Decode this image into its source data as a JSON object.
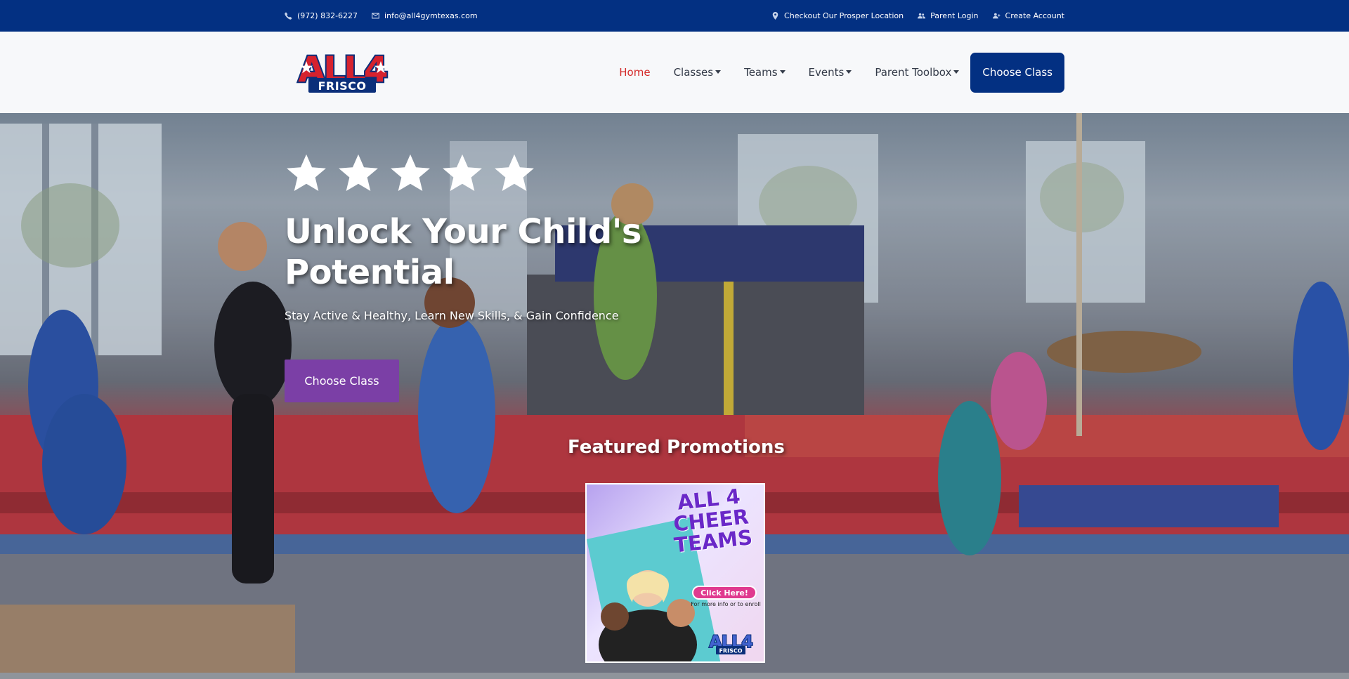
{
  "topbar": {
    "phone": "(972) 832-6227",
    "email": "info@all4gymtexas.com",
    "location_link": "Checkout Our Prosper Location",
    "parent_login": "Parent Login",
    "create_account": "Create Account"
  },
  "logo": {
    "top": "ALL4",
    "bottom": "FRISCO"
  },
  "nav": {
    "home": "Home",
    "classes": "Classes",
    "teams": "Teams",
    "events": "Events",
    "parent_toolbox": "Parent Toolbox",
    "cta": "Choose Class"
  },
  "hero": {
    "rating_stars": 5,
    "title": "Unlock Your Child's Potential",
    "subtitle": "Stay Active & Healthy, Learn New Skills, & Gain Confidence",
    "cta": "Choose Class"
  },
  "promotions": {
    "heading": "Featured Promotions",
    "card": {
      "title": "ALL 4 CHEER TEAMS",
      "button": "Click Here!",
      "note": "For more info or to enroll",
      "logo_top": "ALL4",
      "logo_bottom": "FRISCO"
    }
  },
  "colors": {
    "topbar": "#033082",
    "brand_red": "#d42a2a",
    "brand_navy": "#033082",
    "hero_button": "#7b3fa6"
  },
  "icons": [
    "phone-icon",
    "envelope-icon",
    "map-pin-icon",
    "users-icon",
    "user-plus-icon",
    "star-icon"
  ]
}
